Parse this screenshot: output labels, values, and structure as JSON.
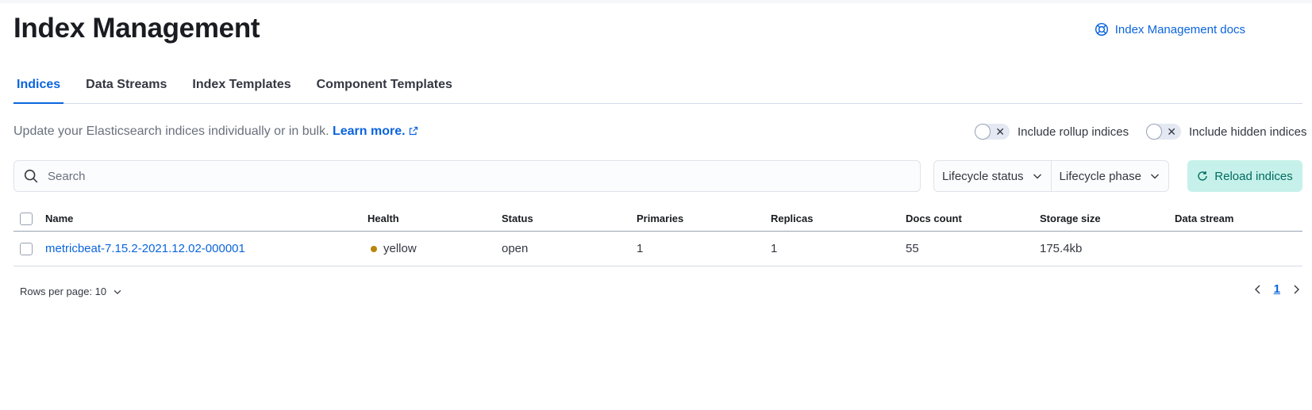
{
  "header": {
    "title": "Index Management",
    "docs_link": "Index Management docs"
  },
  "tabs": [
    {
      "label": "Indices",
      "active": true
    },
    {
      "label": "Data Streams",
      "active": false
    },
    {
      "label": "Index Templates",
      "active": false
    },
    {
      "label": "Component Templates",
      "active": false
    }
  ],
  "description": {
    "text": "Update your Elasticsearch indices individually or in bulk.",
    "link": "Learn more."
  },
  "toggles": {
    "rollup": {
      "label": "Include rollup indices",
      "checked": false
    },
    "hidden": {
      "label": "Include hidden indices",
      "checked": false
    }
  },
  "search": {
    "placeholder": "Search",
    "value": ""
  },
  "filters": {
    "lifecycle_status": "Lifecycle status",
    "lifecycle_phase": "Lifecycle phase"
  },
  "reload_button": "Reload indices",
  "table": {
    "columns": [
      "Name",
      "Health",
      "Status",
      "Primaries",
      "Replicas",
      "Docs count",
      "Storage size",
      "Data stream"
    ],
    "rows": [
      {
        "name": "metricbeat-7.15.2-2021.12.02-000001",
        "health": "yellow",
        "status": "open",
        "primaries": "1",
        "replicas": "1",
        "docs_count": "55",
        "storage_size": "175.4kb",
        "data_stream": ""
      }
    ]
  },
  "pagination": {
    "rows_per_page": "Rows per page: 10",
    "current_page": "1"
  },
  "colors": {
    "primary": "#0b64dd",
    "health_yellow": "#b8860b",
    "reload_bg": "#c6f1ea"
  }
}
